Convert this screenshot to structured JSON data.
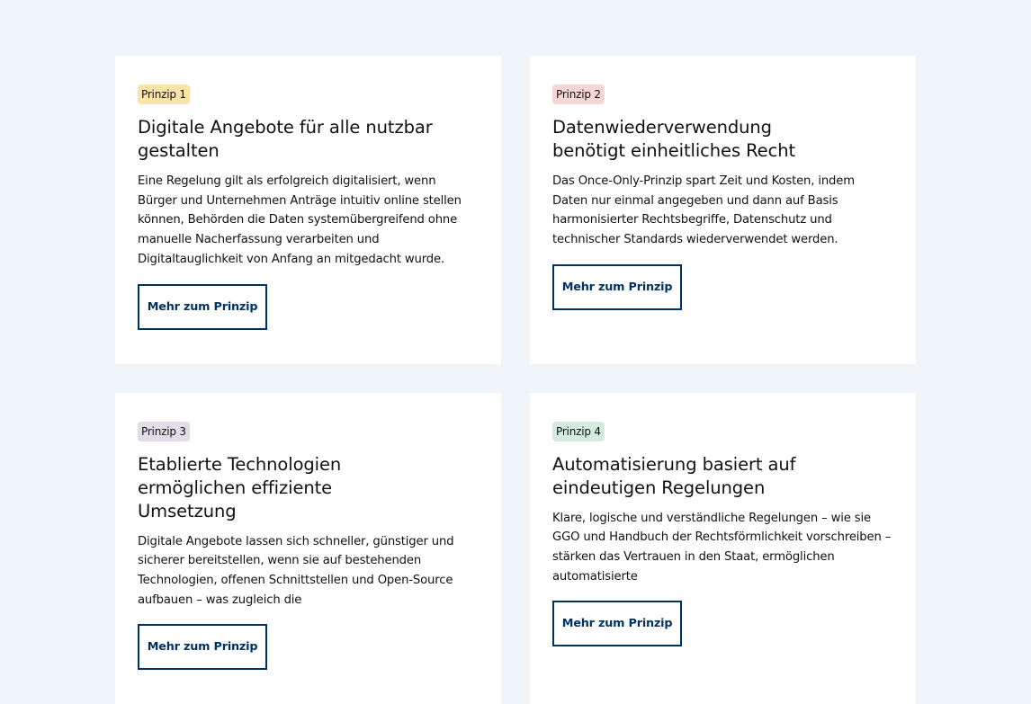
{
  "principles": [
    {
      "badge": "Prinzip 1",
      "badge_color": "#fbe4a7",
      "title": "Digitale Angebote für alle nutzbar gestalten",
      "description": "Eine Regelung gilt als erfolgreich digitalisiert, wenn Bürger und Unternehmen Anträge intuitiv online stellen können, Behörden die Daten systemübergreifend ohne manuelle Nacherfassung verarbeiten und Digitaltauglichkeit von Anfang an mitgedacht wurde.",
      "button": "Mehr zum Prinzip"
    },
    {
      "badge": "Prinzip 2",
      "badge_color": "#f6d7d5",
      "title": "Datenwiederverwendung benötigt einheitliches Recht",
      "description": "Das Once-Only-Prinzip spart Zeit und Kosten, indem Daten nur einmal angegeben und dann auf Basis harmonisierter Rechtsbegriffe, Datenschutz und technischer Standards wiederverwendet werden.",
      "button": "Mehr zum Prinzip"
    },
    {
      "badge": "Prinzip 3",
      "badge_color": "#e3dde7",
      "title": "Etablierte Technologien ermöglichen effiziente Umsetzung",
      "description": "Digitale Angebote lassen sich schneller, günstiger und sicherer bereitstellen, wenn sie auf bestehenden Technologien, offenen Schnittstellen und Open-Source aufbauen – was zugleich die",
      "button": "Mehr zum Prinzip"
    },
    {
      "badge": "Prinzip 4",
      "badge_color": "#d4ece0",
      "title": "Automatisierung basiert auf eindeutigen Regelungen",
      "description": "Klare, logische und verständliche Regelungen – wie sie GGO und Handbuch der Rechtsförmlichkeit vorschreiben – stärken das Vertrauen in den Staat, ermöglichen automatisierte",
      "button": "Mehr zum Prinzip"
    }
  ]
}
